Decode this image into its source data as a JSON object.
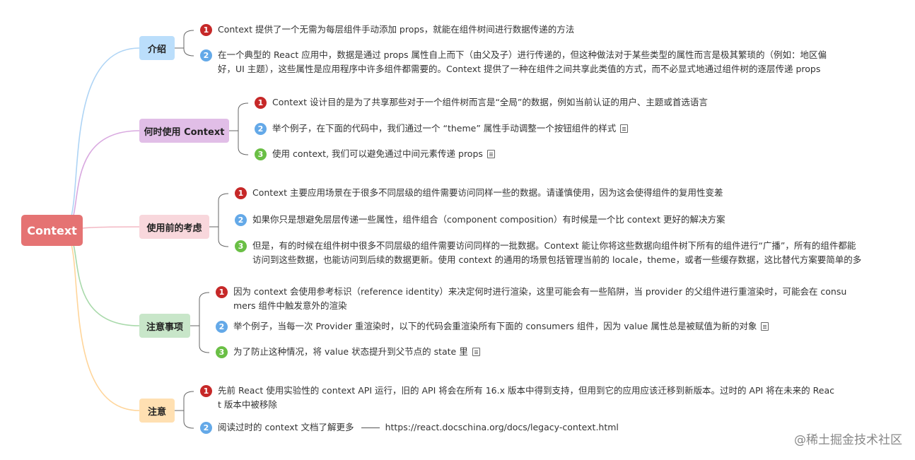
{
  "root": {
    "label": "Context",
    "color": "#e57373"
  },
  "branches": [
    {
      "label": "介绍",
      "color": "#bbdefb",
      "items": [
        {
          "num": "1",
          "lines": [
            "Context 提供了一个无需为每层组件手动添加 props，就能在组件树间进行数据传递的方法"
          ]
        },
        {
          "num": "2",
          "lines": [
            "在一个典型的 React 应用中，数据是通过 props 属性自上而下（由父及子）进行传递的，但这种做法对于某些类型的属性而言是极其繁琐的（例如：地区偏",
            "好，UI 主题），这些属性是应用程序中许多组件都需要的。Context 提供了一种在组件之间共享此类值的方式，而不必显式地通过组件树的逐层传递 props"
          ]
        }
      ]
    },
    {
      "label": "何时使用 Context",
      "color": "#e1bee7",
      "items": [
        {
          "num": "1",
          "lines": [
            "Context 设计目的是为了共享那些对于一个组件树而言是“全局”的数据，例如当前认证的用户、主题或首选语言"
          ]
        },
        {
          "num": "2",
          "lines": [
            "举个例子，在下面的代码中，我们通过一个 “theme” 属性手动调整一个按钮组件的样式"
          ],
          "note": "note-icon"
        },
        {
          "num": "3",
          "lines": [
            "使用 context, 我们可以避免通过中间元素传递 props"
          ],
          "note": "note-icon"
        }
      ]
    },
    {
      "label": "使用前的考虑",
      "color": "#f8d7dc",
      "items": [
        {
          "num": "1",
          "lines": [
            "Context 主要应用场景在于很多不同层级的组件需要访问同样一些的数据。请谨慎使用，因为这会使得组件的复用性变差"
          ]
        },
        {
          "num": "2",
          "lines": [
            "如果你只是想避免层层传递一些属性，组件组合（component composition）有时候是一个比 context 更好的解决方案"
          ]
        },
        {
          "num": "3",
          "lines": [
            "但是，有的时候在组件树中很多不同层级的组件需要访问同样的一批数据。Context 能让你将这些数据向组件树下所有的组件进行“广播”，所有的组件都能",
            "访问到这些数据，也能访问到后续的数据更新。使用 context 的通用的场景包括管理当前的 locale，theme，或者一些缓存数据，这比替代方案要简单的多"
          ]
        }
      ]
    },
    {
      "label": "注意事项",
      "color": "#c8e6c9",
      "items": [
        {
          "num": "1",
          "lines": [
            "因为 context 会使用参考标识（reference identity）来决定何时进行渲染，这里可能会有一些陷阱，当 provider 的父组件进行重渲染时，可能会在 consu",
            "mers 组件中触发意外的渲染"
          ]
        },
        {
          "num": "2",
          "lines": [
            "举个例子，当每一次 Provider 重渲染时，以下的代码会重渲染所有下面的 consumers 组件，因为 value 属性总是被赋值为新的对象"
          ],
          "note": "note-icon"
        },
        {
          "num": "3",
          "lines": [
            "为了防止这种情况，将 value 状态提升到父节点的 state 里"
          ],
          "note": "note-icon"
        }
      ]
    },
    {
      "label": "注意",
      "color": "#ffe0b2",
      "items": [
        {
          "num": "1",
          "lines": [
            "先前 React 使用实验性的 context API 运行，旧的 API 将会在所有 16.x 版本中得到支持，但用到它的应用应该迁移到新版本。过时的 API 将在未来的 Reac",
            "t 版本中被移除"
          ]
        },
        {
          "num": "2",
          "lines": [
            "阅读过时的 context 文档了解更多"
          ],
          "link": "https://react.docschina.org/docs/legacy-context.html"
        }
      ]
    }
  ],
  "watermark": "@稀土掘金技术社区",
  "colors": {
    "red": "#c62828",
    "blue": "#64a9e8",
    "green": "#6abf45"
  }
}
